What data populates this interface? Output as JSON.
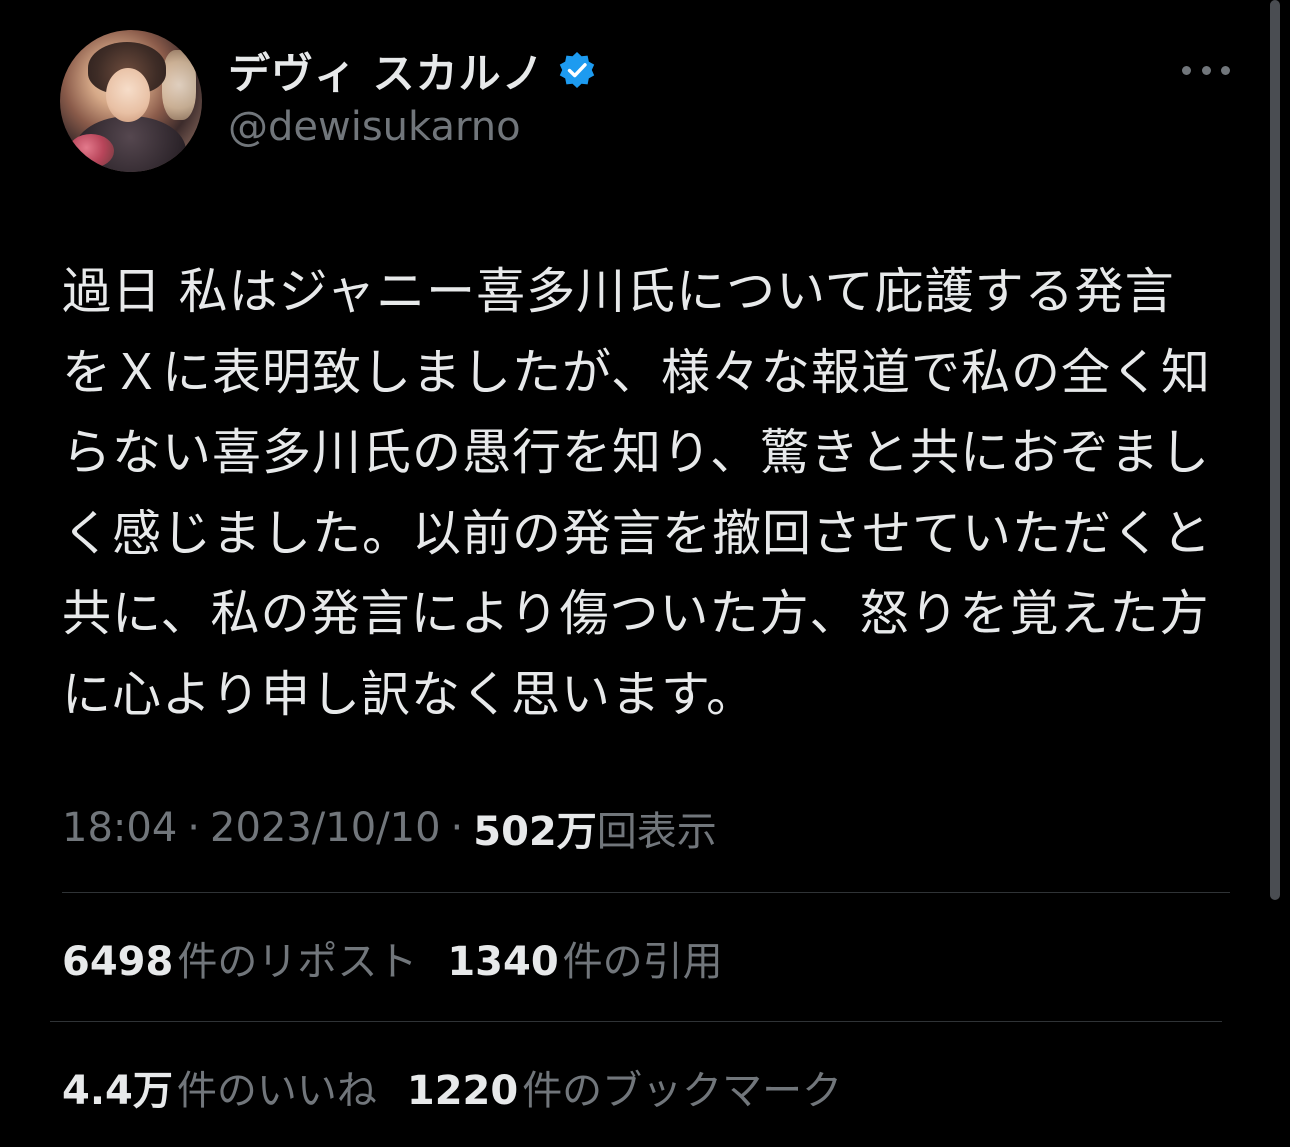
{
  "user": {
    "display_name": "デヴィ スカルノ",
    "handle": "@dewisukarno",
    "verified_icon": "verified-badge-icon",
    "badge_color": "#1d9bf0"
  },
  "post": {
    "lines": [
      "過日 私はジャニー喜多川氏について庇護する発言",
      "をＸに表明致しましたが、様々な報道で私の全く知",
      "らない喜多川氏の愚行を知り、驚きと共におぞまし",
      "く感じました。以前の発言を撤回させていただくと",
      "共に、私の発言により傷ついた方、怒りを覚えた方",
      "に心より申し訳なく思います。"
    ]
  },
  "meta": {
    "time": "18:04",
    "separator": "·",
    "date": "2023/10/10",
    "views_count": "502万",
    "views_label": "回表示"
  },
  "stats": {
    "reposts_count": "6498",
    "reposts_label": "件のリポスト",
    "quotes_count": "1340",
    "quotes_label": "件の引用",
    "likes_count": "4.4万",
    "likes_label": "件のいいね",
    "bookmarks_count": "1220",
    "bookmarks_label": "件のブックマーク"
  },
  "colors": {
    "background": "#000000",
    "primary_text": "#e7e9ea",
    "secondary_text": "#71767b",
    "divider": "#2f3336"
  }
}
